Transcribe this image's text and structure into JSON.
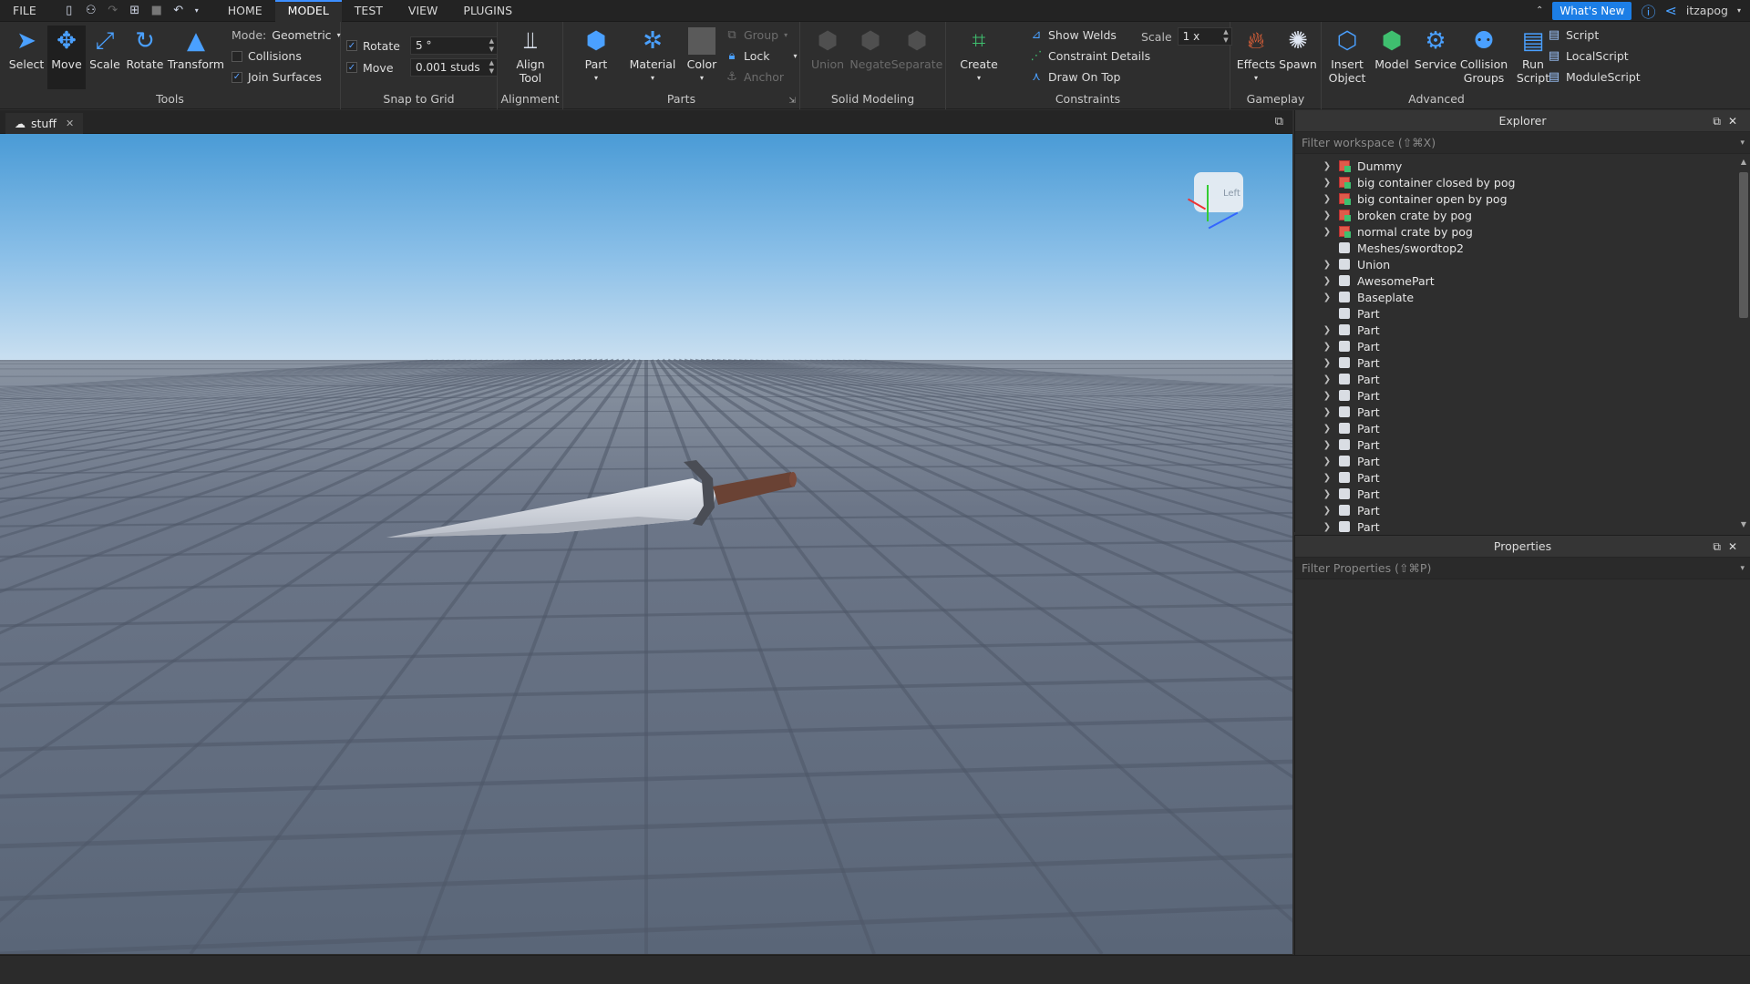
{
  "menubar": {
    "file": "FILE",
    "tabs": [
      "HOME",
      "MODEL",
      "TEST",
      "VIEW",
      "PLUGINS"
    ],
    "active_tab": "MODEL",
    "whats_new": "What's New",
    "username": "itzapog"
  },
  "ribbon": {
    "tools": {
      "label": "Tools",
      "buttons": [
        "Select",
        "Move",
        "Scale",
        "Rotate",
        "Transform"
      ],
      "mode_label": "Mode:",
      "mode_value": "Geometric",
      "collisions": "Collisions",
      "join_surfaces": "Join Surfaces"
    },
    "snap": {
      "label": "Snap to Grid",
      "rotate_label": "Rotate",
      "rotate_value": "5 °",
      "move_label": "Move",
      "move_value": "0.001 studs"
    },
    "alignment": {
      "label": "Alignment",
      "align_tool": "Align Tool"
    },
    "parts": {
      "label": "Parts",
      "part": "Part",
      "material": "Material",
      "color": "Color",
      "group": "Group",
      "lock": "Lock",
      "anchor": "Anchor"
    },
    "solid_modeling": {
      "label": "Solid Modeling",
      "union": "Union",
      "negate": "Negate",
      "separate": "Separate"
    },
    "constraints": {
      "label": "Constraints",
      "create": "Create",
      "show_welds": "Show Welds",
      "constraint_details": "Constraint Details",
      "draw_on_top": "Draw On Top",
      "scale_label": "Scale",
      "scale_value": "1 x"
    },
    "gameplay": {
      "label": "Gameplay",
      "effects": "Effects",
      "spawn": "Spawn"
    },
    "advanced": {
      "label": "Advanced",
      "insert_object": "Insert Object",
      "model": "Model",
      "service": "Service",
      "collision_groups": "Collision Groups",
      "run_script": "Run Script",
      "script": "Script",
      "local_script": "LocalScript",
      "module_script": "ModuleScript"
    }
  },
  "doc_tab": {
    "title": "stuff"
  },
  "viewcube": {
    "face": "Left"
  },
  "explorer": {
    "title": "Explorer",
    "filter_placeholder": "Filter workspace (⇧⌘X)",
    "items": [
      {
        "name": "Dummy",
        "expand": true,
        "icon": "model"
      },
      {
        "name": "big container closed by pog",
        "expand": true,
        "icon": "model"
      },
      {
        "name": "big container open by pog",
        "expand": true,
        "icon": "model"
      },
      {
        "name": "broken crate by pog",
        "expand": true,
        "icon": "model"
      },
      {
        "name": "normal crate by pog",
        "expand": true,
        "icon": "model"
      },
      {
        "name": "Meshes/swordtop2",
        "expand": false,
        "icon": "part"
      },
      {
        "name": "Union",
        "expand": true,
        "icon": "part"
      },
      {
        "name": "AwesomePart",
        "expand": true,
        "icon": "part"
      },
      {
        "name": "Baseplate",
        "expand": true,
        "icon": "part"
      },
      {
        "name": "Part",
        "expand": false,
        "icon": "part"
      },
      {
        "name": "Part",
        "expand": true,
        "icon": "part"
      },
      {
        "name": "Part",
        "expand": true,
        "icon": "part"
      },
      {
        "name": "Part",
        "expand": true,
        "icon": "part"
      },
      {
        "name": "Part",
        "expand": true,
        "icon": "part"
      },
      {
        "name": "Part",
        "expand": true,
        "icon": "part"
      },
      {
        "name": "Part",
        "expand": true,
        "icon": "part"
      },
      {
        "name": "Part",
        "expand": true,
        "icon": "part"
      },
      {
        "name": "Part",
        "expand": true,
        "icon": "part"
      },
      {
        "name": "Part",
        "expand": true,
        "icon": "part"
      },
      {
        "name": "Part",
        "expand": true,
        "icon": "part"
      },
      {
        "name": "Part",
        "expand": true,
        "icon": "part"
      },
      {
        "name": "Part",
        "expand": true,
        "icon": "part"
      },
      {
        "name": "Part",
        "expand": true,
        "icon": "part"
      }
    ]
  },
  "properties": {
    "title": "Properties",
    "filter_placeholder": "Filter Properties (⇧⌘P)"
  },
  "colors": {
    "accent": "#1c7ee6",
    "sky_top": "#4a9bd6",
    "sky_horizon": "#c9dff0",
    "ground": "#5f6c7e"
  }
}
